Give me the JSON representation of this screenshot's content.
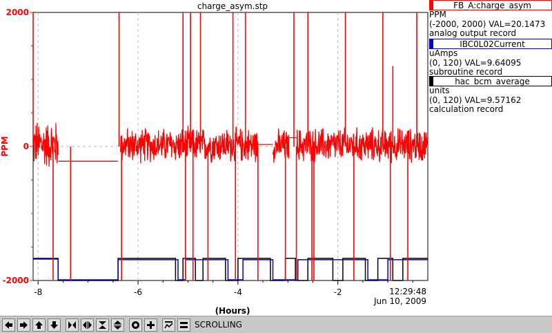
{
  "chart_data": {
    "type": "line",
    "title": "charge_asym.stp",
    "xlabel": "(Hours)",
    "ylabel": "PPM",
    "xlim": [
      -8.1,
      -0.2
    ],
    "ylim": [
      -2000,
      2000
    ],
    "x_ticks": [
      -8,
      -6,
      -4,
      -2
    ],
    "x_tick_labels": [
      "-8",
      "-6",
      "-4",
      "-2"
    ],
    "y_ticks": [
      -2000,
      0,
      2000
    ],
    "y_tick_labels": [
      "-2000",
      "0",
      "2000"
    ],
    "grid": true,
    "time_label": "12:29:48",
    "date_label": "Jun 10, 2009",
    "series": [
      {
        "color": "#ff0000",
        "segments": [
          {
            "type": "noise",
            "x0": -8.1,
            "x1": -7.6,
            "mean": 30,
            "amp": 320
          },
          {
            "type": "flat",
            "x0": -7.6,
            "x1": -6.4,
            "y": -220
          },
          {
            "type": "noise",
            "x0": -6.35,
            "x1": -3.6,
            "mean": 20,
            "amp": 230
          },
          {
            "type": "flat",
            "x0": -3.6,
            "x1": -3.3,
            "y": 30
          },
          {
            "type": "noise",
            "x0": -3.3,
            "x1": -2.98,
            "mean": 10,
            "amp": 220
          },
          {
            "type": "flat",
            "x0": -2.98,
            "x1": -2.82,
            "y": 130
          },
          {
            "type": "noise",
            "x0": -2.82,
            "x1": -0.2,
            "mean": 20,
            "amp": 230
          }
        ],
        "spikes": [
          {
            "x": -8.1,
            "y": 2000
          },
          {
            "x": -7.7,
            "y": -2000
          },
          {
            "x": -7.35,
            "y": -2000
          },
          {
            "x": -6.38,
            "y": 2000
          },
          {
            "x": -6.33,
            "y": -2000
          },
          {
            "x": -5.1,
            "y": 2000
          },
          {
            "x": -5.05,
            "y": -2000
          },
          {
            "x": -4.95,
            "y": 2000
          },
          {
            "x": -4.9,
            "y": -2000
          },
          {
            "x": -4.75,
            "y": 2000
          },
          {
            "x": -4.6,
            "y": -2000
          },
          {
            "x": -4.1,
            "y": 2000
          },
          {
            "x": -4.05,
            "y": -2000
          },
          {
            "x": -3.85,
            "y": 2000
          },
          {
            "x": -3.6,
            "y": -2000
          },
          {
            "x": -3.05,
            "y": -2000
          },
          {
            "x": -2.88,
            "y": 2000
          },
          {
            "x": -2.83,
            "y": -2000
          },
          {
            "x": -2.6,
            "y": 2000
          },
          {
            "x": -2.52,
            "y": -2000
          },
          {
            "x": -2.48,
            "y": -2000
          },
          {
            "x": -1.85,
            "y": 2000
          },
          {
            "x": -1.68,
            "y": -2000
          },
          {
            "x": -1.1,
            "y": 2000
          },
          {
            "x": -0.95,
            "y": -2000
          },
          {
            "x": -0.9,
            "y": 1200
          },
          {
            "x": -0.6,
            "y": -2000
          },
          {
            "x": -0.42,
            "y": 2000
          }
        ]
      },
      {
        "color": "#0000cc",
        "levels": [
          -1700,
          -2000
        ],
        "points": [
          [
            -8.1,
            -1680
          ],
          [
            -7.6,
            -1680
          ],
          [
            -7.6,
            -1990
          ],
          [
            -6.4,
            -1990
          ],
          [
            -6.4,
            -1690
          ],
          [
            -5.2,
            -1690
          ],
          [
            -5.2,
            -1990
          ],
          [
            -5.05,
            -1990
          ],
          [
            -5.05,
            -1690
          ],
          [
            -4.2,
            -1690
          ],
          [
            -4.2,
            -1990
          ],
          [
            -3.9,
            -1990
          ],
          [
            -3.9,
            -1690
          ],
          [
            -3.3,
            -1690
          ],
          [
            -3.3,
            -1990
          ],
          [
            -2.8,
            -1990
          ],
          [
            -2.8,
            -1690
          ],
          [
            -1.4,
            -1690
          ],
          [
            -1.4,
            -1990
          ],
          [
            -1.0,
            -1990
          ],
          [
            -1.0,
            -1690
          ],
          [
            -0.2,
            -1690
          ]
        ]
      },
      {
        "color": "#000000",
        "points": [
          [
            -8.1,
            -1670
          ],
          [
            -7.6,
            -1670
          ],
          [
            -7.6,
            -2000
          ],
          [
            -6.4,
            -2000
          ],
          [
            -6.4,
            -1670
          ],
          [
            -5.25,
            -1670
          ],
          [
            -5.25,
            -2000
          ],
          [
            -5.1,
            -2000
          ],
          [
            -5.1,
            -1670
          ],
          [
            -4.85,
            -1670
          ],
          [
            -4.85,
            -2000
          ],
          [
            -4.7,
            -2000
          ],
          [
            -4.7,
            -1670
          ],
          [
            -4.25,
            -1670
          ],
          [
            -4.25,
            -2000
          ],
          [
            -4.0,
            -2000
          ],
          [
            -4.0,
            -1670
          ],
          [
            -3.35,
            -1670
          ],
          [
            -3.35,
            -2000
          ],
          [
            -3.05,
            -2000
          ],
          [
            -3.05,
            -1670
          ],
          [
            -2.85,
            -1670
          ],
          [
            -2.85,
            -2000
          ],
          [
            -2.6,
            -2000
          ],
          [
            -2.6,
            -1670
          ],
          [
            -2.1,
            -1670
          ],
          [
            -2.1,
            -2000
          ],
          [
            -1.9,
            -2000
          ],
          [
            -1.9,
            -1670
          ],
          [
            -1.45,
            -1670
          ],
          [
            -1.45,
            -2000
          ],
          [
            -1.2,
            -2000
          ],
          [
            -1.2,
            -1670
          ],
          [
            -0.9,
            -1670
          ],
          [
            -0.9,
            -2000
          ],
          [
            -0.7,
            -2000
          ],
          [
            -0.7,
            -1670
          ],
          [
            -0.2,
            -1670
          ]
        ]
      }
    ]
  },
  "legend": [
    {
      "name": "FB_A:charge_asym",
      "color": "#ff0000",
      "units": "PPM",
      "range": "(-2000, 2000) VAL=20.1473",
      "record": "analog output record"
    },
    {
      "name": "IBC0L02Current",
      "color": "#0000cc",
      "units": "uAmps",
      "range": "(0, 120) VAL=9.64095",
      "record": "subroutine record"
    },
    {
      "name": "hac_bcm_average",
      "color": "#000000",
      "units": "units",
      "range": "(0, 120) VAL=9.57162",
      "record": "calculation record"
    }
  ],
  "toolbar": {
    "icons": [
      "arrow-left-icon",
      "arrow-right-icon",
      "arrow-up-icon",
      "arrow-down-icon",
      "compress-horizontal-icon",
      "expand-horizontal-icon",
      "compress-vertical-icon",
      "expand-vertical-icon",
      "record-icon",
      "plus-icon",
      "autoscale-icon",
      "split-icon"
    ],
    "status": "SCROLLING"
  }
}
